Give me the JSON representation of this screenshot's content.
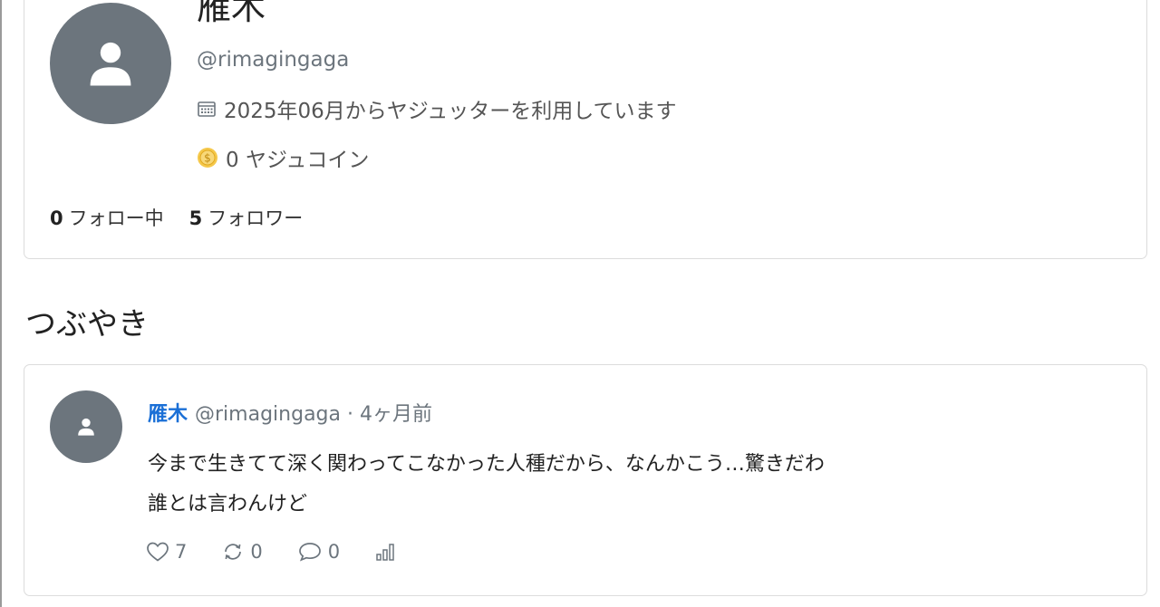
{
  "profile": {
    "display_name": "雁木",
    "handle": "@rimagingaga",
    "joined_text": "2025年06月からヤジュッターを利用しています",
    "coin_text": "0 ヤジュコイン",
    "following_count": "0",
    "following_label": "フォロー中",
    "followers_count": "5",
    "followers_label": "フォロワー"
  },
  "section": {
    "title": "つぶやき"
  },
  "posts": [
    {
      "author": "雁木",
      "handle": "@rimagingaga",
      "separator": "·",
      "time": "4ヶ月前",
      "lines": [
        "今まで生きてて深く関わってこなかった人種だから、なんかこう…驚きだわ",
        "誰とは言わんけど"
      ],
      "likes": "7",
      "reposts": "0",
      "replies": "0"
    }
  ],
  "icons": {
    "avatar": "person-icon",
    "calendar": "calendar-icon",
    "coin": "coin-icon",
    "like": "heart-icon",
    "repost": "repost-icon",
    "reply": "comment-icon",
    "stats": "bar-chart-icon"
  },
  "colors": {
    "avatar_bg": "#6c757d",
    "author_link": "#1a6fd6",
    "coin": "#f2c200"
  }
}
